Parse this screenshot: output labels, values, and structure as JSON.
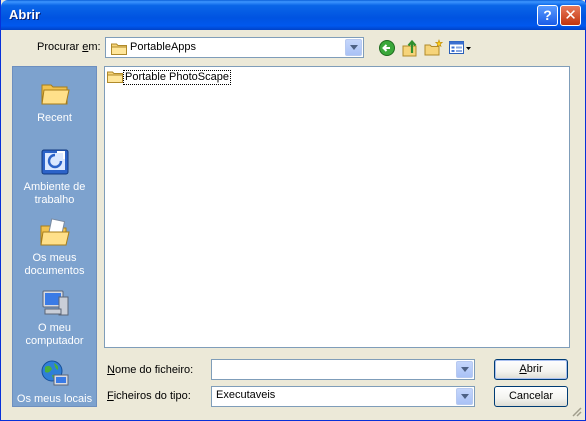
{
  "window": {
    "title": "Abrir",
    "help_glyph": "?",
    "close_glyph": "✕"
  },
  "lookin": {
    "label_prefix": "Procurar ",
    "label_accel": "e",
    "label_suffix": "m:",
    "value": "PortableApps"
  },
  "toolbar": {
    "icons": [
      "back-icon",
      "up-folder-icon",
      "new-folder-icon",
      "view-menu-icon"
    ]
  },
  "places": [
    {
      "label": "Recent",
      "icon": "recent-icon"
    },
    {
      "label": "Ambiente de trabalho",
      "icon": "desktop-icon"
    },
    {
      "label": "Os meus documentos",
      "icon": "documents-icon"
    },
    {
      "label": "O meu computador",
      "icon": "computer-icon"
    },
    {
      "label": "Os meus locais",
      "icon": "network-icon"
    }
  ],
  "files": [
    {
      "name": "Portable PhotoScape",
      "icon": "folder-icon"
    }
  ],
  "filename": {
    "label_accel": "N",
    "label_rest": "ome do ficheiro:",
    "value": ""
  },
  "filetype": {
    "label_accel": "F",
    "label_rest": "icheiros do tipo:",
    "value": "Executaveis"
  },
  "buttons": {
    "open_accel": "A",
    "open_rest": "brir",
    "cancel": "Cancelar"
  },
  "colors": {
    "title_bar": "#0053e1",
    "places_bg": "#7da2ce",
    "dialog_bg": "#ece9d8"
  }
}
